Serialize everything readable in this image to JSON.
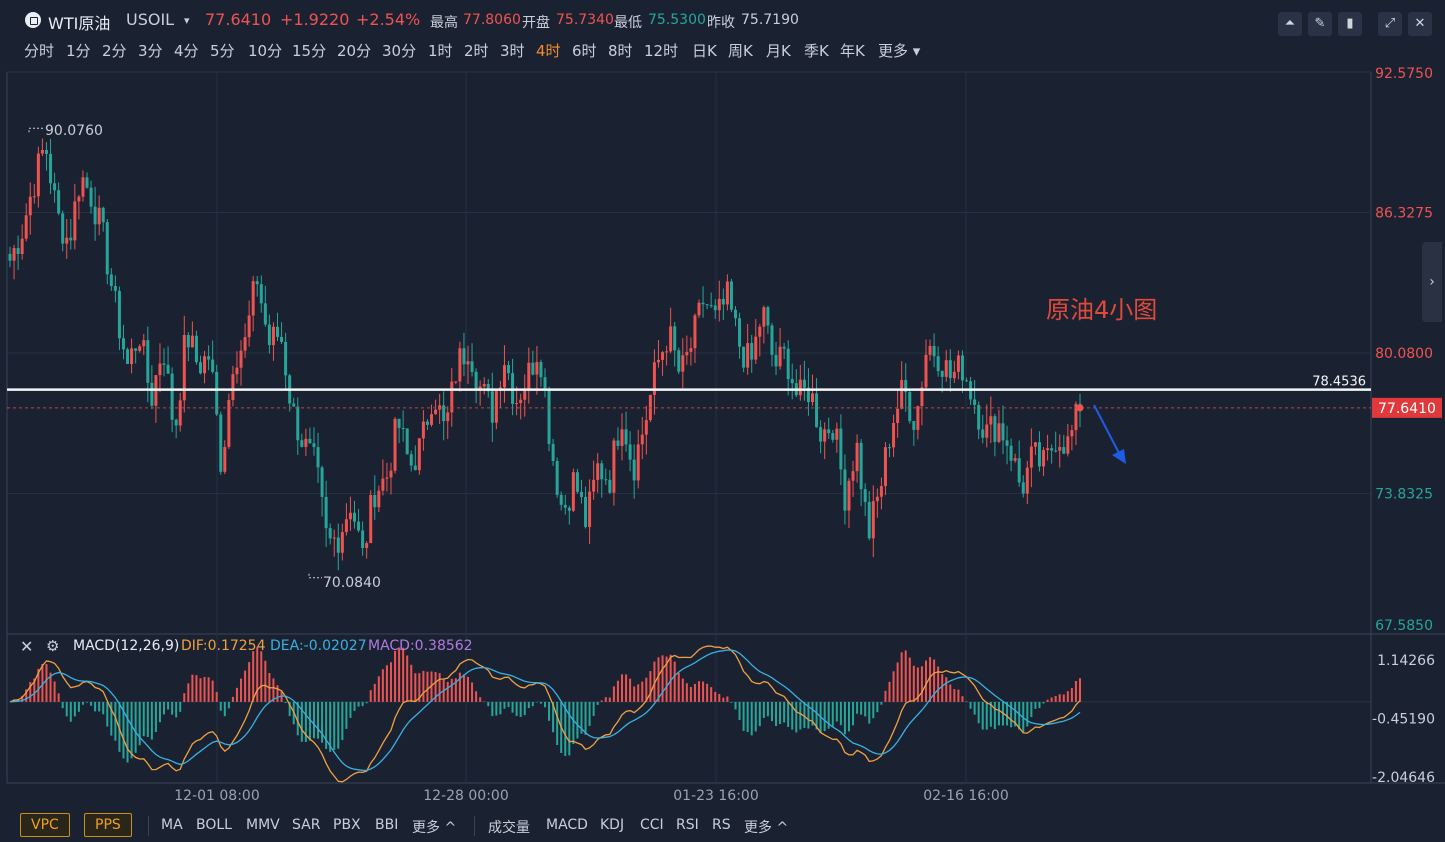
{
  "header": {
    "symbol_name": "WTI原油",
    "symbol_code": "USOIL",
    "price": "77.6410",
    "change": "+1.9220",
    "change_pct": "+2.54%",
    "high_label": "最高",
    "high": "77.8060",
    "open_label": "开盘",
    "open": "75.7340",
    "low_label": "最低",
    "low": "75.5300",
    "prev_label": "昨收",
    "prev": "75.7190"
  },
  "periods": [
    {
      "label": "分时"
    },
    {
      "label": "1分"
    },
    {
      "label": "2分"
    },
    {
      "label": "3分"
    },
    {
      "label": "4分"
    },
    {
      "label": "5分"
    },
    {
      "label": "10分"
    },
    {
      "label": "15分"
    },
    {
      "label": "20分"
    },
    {
      "label": "30分"
    },
    {
      "label": "1时"
    },
    {
      "label": "2时"
    },
    {
      "label": "3时"
    },
    {
      "label": "4时",
      "active": true
    },
    {
      "label": "6时"
    },
    {
      "label": "8时"
    },
    {
      "label": "12时"
    },
    {
      "label": "日K"
    },
    {
      "label": "周K"
    },
    {
      "label": "月K"
    },
    {
      "label": "季K"
    },
    {
      "label": "年K"
    },
    {
      "label": "更多"
    }
  ],
  "annotation": "原油4小图",
  "colors": {
    "up": "#ef5350",
    "down": "#26a69a",
    "dif": "#f0a040",
    "dea": "#3ab0e0",
    "arrow": "#1e5ce6"
  },
  "chart_data": {
    "type": "candlestick",
    "y_ticks": [
      "92.5750",
      "86.3275",
      "80.0800",
      "73.8325",
      "67.5850"
    ],
    "ylim": [
      67.585,
      92.575
    ],
    "x_ticks": [
      "12-01 08:00",
      "12-28 00:00",
      "01-23 16:00",
      "02-16 16:00"
    ],
    "high_label": "90.0760",
    "low_label": "70.0840",
    "resistance": 78.4536,
    "resistance_label": "78.4536",
    "last_price": 77.641,
    "last_price_label": "77.6410",
    "close_path": [
      84.2,
      85.5,
      87.6,
      89.4,
      86.2,
      85.0,
      88.0,
      87.0,
      85.0,
      82.0,
      79.5,
      81.0,
      78.0,
      80.5,
      76.5,
      81.0,
      79.5,
      80.0,
      75.0,
      80.0,
      80.5,
      83.5,
      80.5,
      81.0,
      77.5,
      76.0,
      75.0,
      71.5,
      72.0,
      73.5,
      71.0,
      74.0,
      74.5,
      77.0,
      75.0,
      76.0,
      78.5,
      76.5,
      79.5,
      80.5,
      78.5,
      77.5,
      80.0,
      78.0,
      79.0,
      80.5,
      76.0,
      73.0,
      74.5,
      72.5,
      75.0,
      74.5,
      77.5,
      75.0,
      77.0,
      79.5,
      81.0,
      79.0,
      80.5,
      82.5,
      81.5,
      82.5,
      80.5,
      79.5,
      82.0,
      79.5,
      80.0,
      78.0,
      78.5,
      76.5,
      77.0,
      73.8,
      76.0,
      72.0,
      74.0,
      77.0,
      78.5,
      77.0,
      80.5,
      80.0,
      79.0,
      79.5,
      78.0,
      76.5,
      77.0,
      76.0,
      74.0,
      75.5,
      75.0,
      76.5,
      76.0,
      77.64
    ]
  },
  "macd": {
    "title": "MACD(12,26,9)",
    "dif": "DIF:0.17254",
    "dea": "DEA:-0.02027",
    "macd": "MACD:0.38562",
    "y_ticks": [
      "1.14266",
      "-0.45190",
      "-2.04646"
    ],
    "ylim": [
      -2.04646,
      1.14266
    ]
  },
  "bottom": {
    "chips": [
      "VPC",
      "PPS"
    ],
    "main_indicators": [
      "MA",
      "BOLL",
      "MMV",
      "SAR",
      "PBX",
      "BBI",
      "更多 ^"
    ],
    "sub_indicators": [
      "成交量",
      "MACD",
      "KDJ",
      "CCI",
      "RSI",
      "RS",
      "更多 ^"
    ]
  }
}
